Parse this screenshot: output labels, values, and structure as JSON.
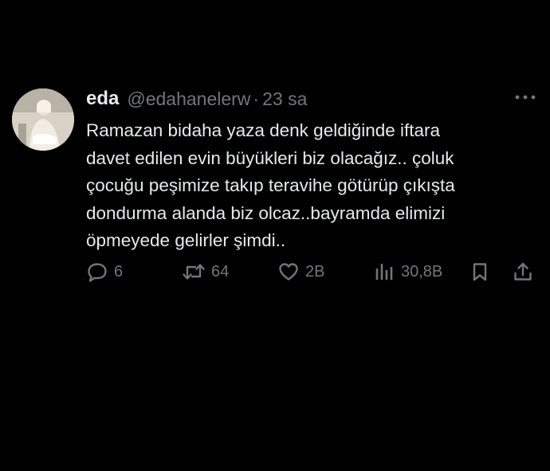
{
  "tweet": {
    "author_name": "eda",
    "author_handle": "@edahanelerw",
    "separator": "·",
    "time": "23 sa",
    "text": "Ramazan bidaha yaza denk geldiğinde iftara\ndavet edilen evin büyükleri biz olacağız.. çoluk\nçocuğu peşimize takıp teravihe götürüp çıkışta\ndondurma alanda biz olcaz..bayramda elimizi\nöpmeyede gelirler şimdi..",
    "replies": "6",
    "retweets": "64",
    "likes": "2B",
    "views": "30,8B"
  },
  "icons": {
    "more": "more-horizontal-icon",
    "reply": "reply-bubble-icon",
    "retweet": "retweet-icon",
    "like": "heart-icon",
    "views": "views-bar-chart-icon",
    "bookmark": "bookmark-icon",
    "share": "share-upload-icon"
  },
  "colors": {
    "background": "#000000",
    "text_primary": "#e7e9ea",
    "text_secondary": "#71767b"
  }
}
